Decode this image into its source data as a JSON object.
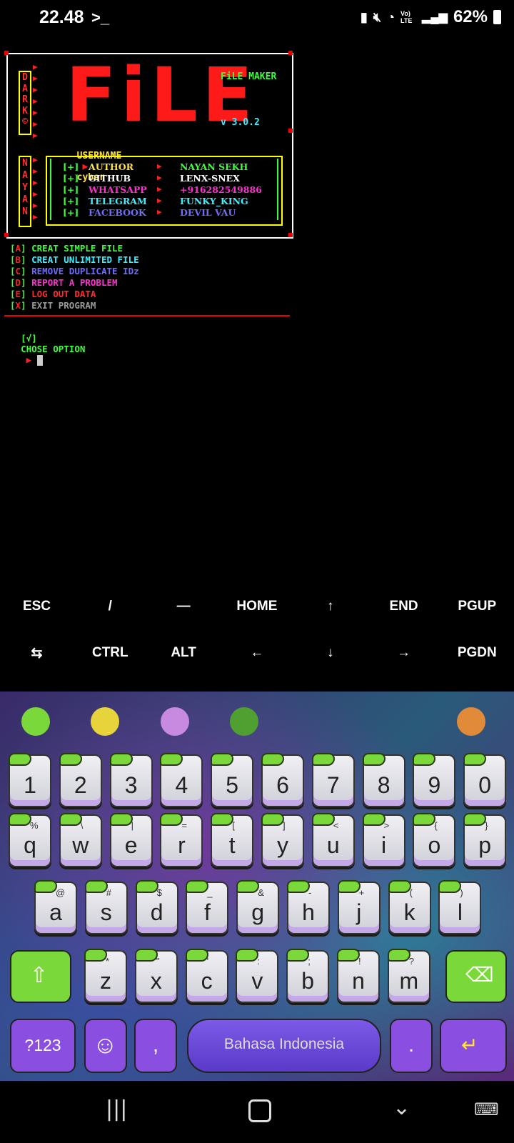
{
  "status_bar": {
    "time": "22.48",
    "prompt_icon": "terminal-prompt-icon",
    "battery": "62%",
    "lte": "Vo) LTE"
  },
  "banner": {
    "vertical_left_top": [
      "D",
      "A",
      "R",
      "K",
      "©"
    ],
    "vertical_left_bottom": [
      "N",
      "A",
      "Y",
      "A",
      "N"
    ],
    "logo": "FiLE",
    "title": "FiLE MAKER",
    "version": "v 3.0.2",
    "username_label": "USERNAME",
    "username_value": "cyber",
    "info": [
      {
        "tag": "[+]",
        "key": "AUTHOR",
        "value": "NAYAN SEKH",
        "color": "#ffe23a",
        "vcolor": "#3cff3c"
      },
      {
        "tag": "[+]",
        "key": "GITHUB",
        "value": "LENX-SNEX",
        "color": "#ffffff",
        "vcolor": "#ffffff"
      },
      {
        "tag": "[+]",
        "key": "WHATSAPP",
        "value": "+916282549886",
        "color": "#ff2fd2",
        "vcolor": "#ff2fd2"
      },
      {
        "tag": "[+]",
        "key": "TELEGRAM",
        "value": "FUNKY_KING",
        "color": "#3cf0ff",
        "vcolor": "#3cf0ff"
      },
      {
        "tag": "[+]",
        "key": "FACEBOOK",
        "value": "DEVIL VAU",
        "color": "#6f6cff",
        "vcolor": "#6f6cff"
      }
    ]
  },
  "menu": [
    {
      "key": "A",
      "label": "CREAT SIMPLE FILE",
      "color": "#3cff3c"
    },
    {
      "key": "B",
      "label": "CREAT UNLIMITED FILE",
      "color": "#3cf0ff"
    },
    {
      "key": "C",
      "label": "REMOVE DUPLICATE IDz",
      "color": "#6f6cff"
    },
    {
      "key": "D",
      "label": "REPORT A PROBLEM",
      "color": "#ff2fd2"
    },
    {
      "key": "E",
      "label": "LOG OUT DATA",
      "color": "#ff2a2a"
    },
    {
      "key": "X",
      "label": "EXIT PROGRAM",
      "color": "#9a9a9a"
    }
  ],
  "prompt": {
    "tag": "[√]",
    "label": "CHOSE OPTION"
  },
  "extra_keys": {
    "row1": [
      "ESC",
      "/",
      "—",
      "HOME",
      "↑",
      "END",
      "PGUP"
    ],
    "row2": [
      "⇆",
      "CTRL",
      "ALT",
      "←",
      "↓",
      "→",
      "PGDN"
    ]
  },
  "keyboard": {
    "numbers": [
      "1",
      "2",
      "3",
      "4",
      "5",
      "6",
      "7",
      "8",
      "9",
      "0"
    ],
    "row1": [
      [
        "q",
        "%"
      ],
      [
        "w",
        "\\"
      ],
      [
        "e",
        "|"
      ],
      [
        "r",
        "="
      ],
      [
        "t",
        "["
      ],
      [
        "y",
        "]"
      ],
      [
        "u",
        "<"
      ],
      [
        "i",
        ">"
      ],
      [
        "o",
        "{"
      ],
      [
        "p",
        "}"
      ]
    ],
    "row2": [
      [
        "a",
        "@"
      ],
      [
        "s",
        "#"
      ],
      [
        "d",
        "$"
      ],
      [
        "f",
        "_"
      ],
      [
        "g",
        "&"
      ],
      [
        "h",
        "-"
      ],
      [
        "j",
        "+"
      ],
      [
        "k",
        "("
      ],
      [
        "l",
        ")"
      ]
    ],
    "row3": [
      [
        "z",
        "*"
      ],
      [
        "x",
        "\""
      ],
      [
        "c",
        "'"
      ],
      [
        "v",
        ":"
      ],
      [
        "b",
        ";"
      ],
      [
        "n",
        "!"
      ],
      [
        "m",
        "?"
      ]
    ],
    "symbols_label": "?123",
    "comma": ",",
    "period": ".",
    "space_label": "Bahasa Indonesia"
  },
  "theme": {
    "accent": "#ff1a1a",
    "slime": "#7bd83a",
    "purple": "#8a4fe0"
  }
}
